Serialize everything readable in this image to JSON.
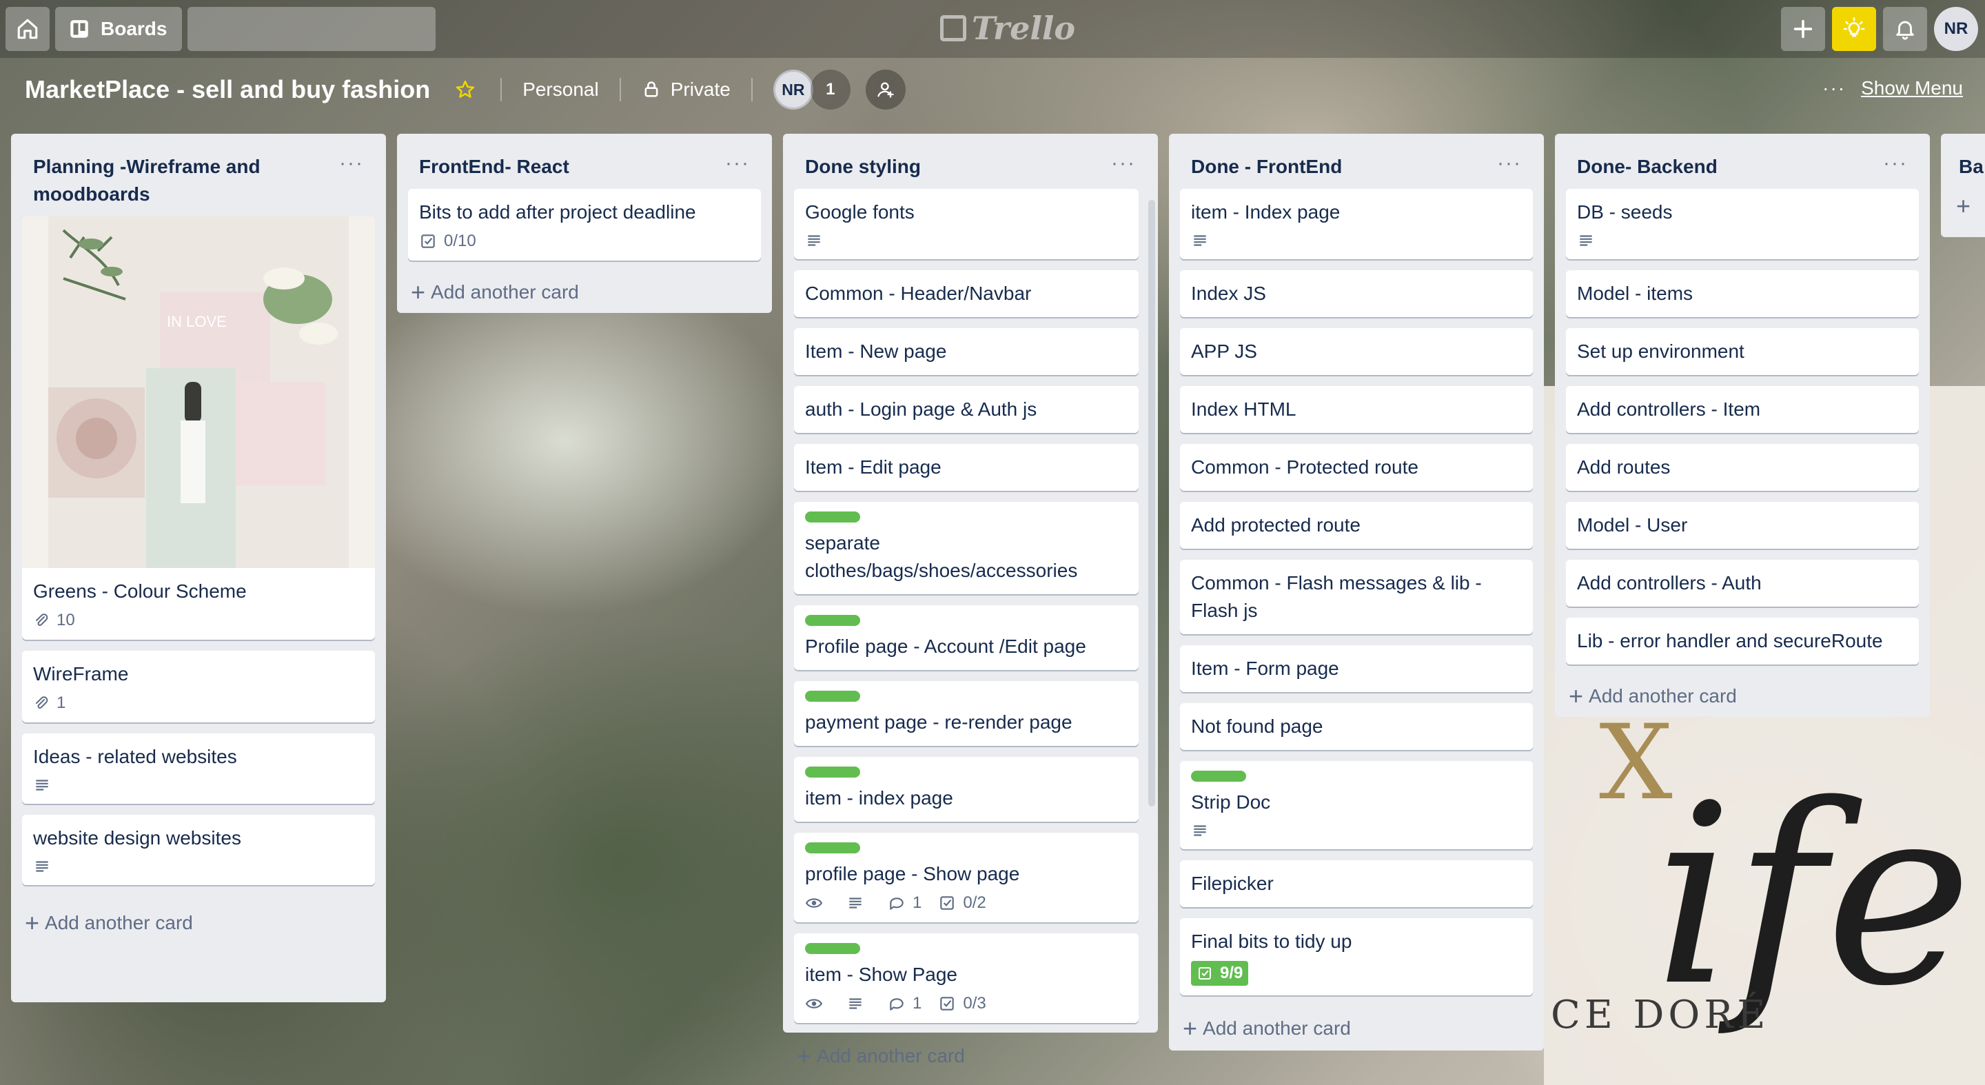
{
  "topbar": {
    "boards_label": "Boards",
    "search_placeholder": "",
    "logo_text": "Trello",
    "user_initials": "NR"
  },
  "board": {
    "title": "MarketPlace - sell and buy fashion",
    "visibility_team": "Personal",
    "visibility": "Private",
    "member_initials": "NR",
    "member_count": "1",
    "show_menu": "Show Menu",
    "menu_dots": "···"
  },
  "background": {
    "logo_letter": "X",
    "word": "ife",
    "caption": "CE DORÉ",
    "moodboard_caption": "IN LOVE"
  },
  "list_menu_glyph": "···",
  "add_card_label": "Add another card",
  "lists": [
    {
      "title": "Planning -Wireframe and moodboards",
      "cards": [
        {
          "title": "Greens - Colour Scheme",
          "attachments": "10"
        },
        {
          "title": "WireFrame",
          "attachments": "1"
        },
        {
          "title": "Ideas - related websites"
        },
        {
          "title": "website design websites"
        }
      ]
    },
    {
      "title": "FrontEnd- React",
      "cards": [
        {
          "title": "Bits to add after project deadline",
          "checklist": "0/10"
        }
      ]
    },
    {
      "title": "Done styling",
      "cards": [
        {
          "title": "Google fonts"
        },
        {
          "title": "Common - Header/Navbar"
        },
        {
          "title": "Item - New page"
        },
        {
          "title": "auth - Login page & Auth js"
        },
        {
          "title": "Item - Edit page"
        },
        {
          "title": "separate clothes/bags/shoes/accessories",
          "label": "green"
        },
        {
          "title": "Profile page - Account /Edit page",
          "label": "green"
        },
        {
          "title": "payment page - re-render page",
          "label": "green"
        },
        {
          "title": "item - index page",
          "label": "green"
        },
        {
          "title": "profile page - Show page",
          "label": "green",
          "comments": "1",
          "checklist": "0/2"
        },
        {
          "title": "item - Show Page",
          "label": "green",
          "comments": "1",
          "checklist": "0/3"
        }
      ]
    },
    {
      "title": "Done - FrontEnd",
      "cards": [
        {
          "title": "item - Index page"
        },
        {
          "title": "Index JS"
        },
        {
          "title": "APP JS"
        },
        {
          "title": "Index HTML"
        },
        {
          "title": "Common - Protected route"
        },
        {
          "title": "Add protected route"
        },
        {
          "title": "Common - Flash messages & lib - Flash js"
        },
        {
          "title": "Item - Form page"
        },
        {
          "title": "Not found page"
        },
        {
          "title": "Strip Doc",
          "label": "green"
        },
        {
          "title": "Filepicker"
        },
        {
          "title": "Final bits to tidy up",
          "checklist": "9/9"
        }
      ]
    },
    {
      "title": "Done- Backend",
      "cards": [
        {
          "title": "DB - seeds"
        },
        {
          "title": "Model - items"
        },
        {
          "title": "Set up environment"
        },
        {
          "title": "Add controllers - Item"
        },
        {
          "title": "Add routes"
        },
        {
          "title": "Model - User"
        },
        {
          "title": "Add controllers - Auth"
        },
        {
          "title": "Lib - error handler and secureRoute"
        }
      ]
    },
    {
      "title": "Ba"
    }
  ],
  "colors": {
    "label_green": "#61bd4f",
    "list_bg": "#ebecf0",
    "yellow_button": "#f2d600"
  }
}
